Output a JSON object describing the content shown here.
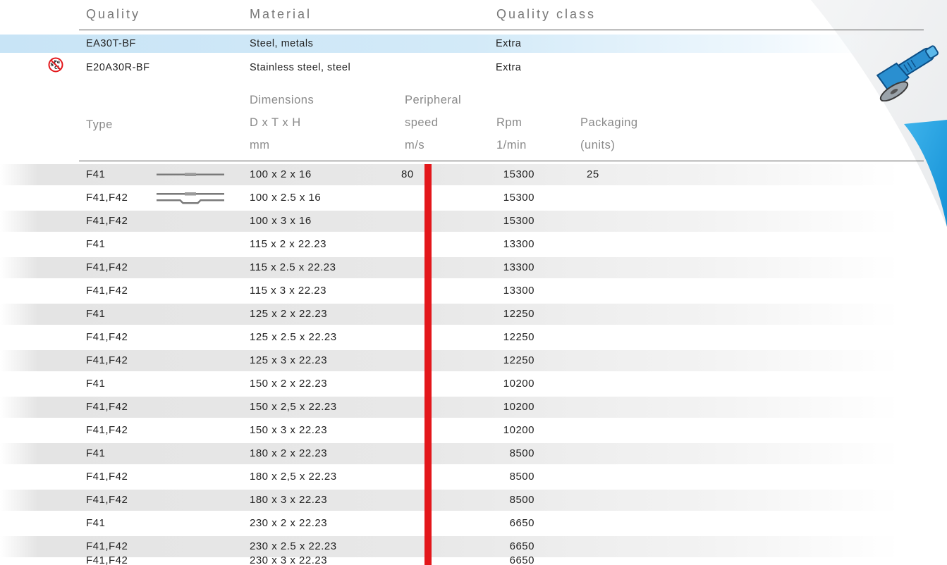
{
  "quality_table": {
    "headers": {
      "quality": "Quality",
      "material": "Material",
      "quality_class": "Quality class"
    },
    "rows": [
      {
        "quality": "EA30T-BF",
        "material": "Steel, metals",
        "quality_class": "Extra",
        "highlighted": true
      },
      {
        "quality": "E20A30R-BF",
        "material": "Stainless steel, steel",
        "quality_class": "Extra",
        "icon": "s-fe-cl-free-icon"
      }
    ]
  },
  "spec_table": {
    "headers": {
      "type": "Type",
      "dimensions": [
        "Dimensions",
        "D x T x H",
        "mm"
      ],
      "speed": [
        "Peripheral",
        "speed",
        "m/s"
      ],
      "rpm": [
        "Rpm",
        "1/min"
      ],
      "packaging": [
        "Packaging",
        "(units)"
      ]
    },
    "rows": [
      {
        "type": "F41",
        "dim": "100 x 2 x 16",
        "speed": "80",
        "rpm": "15300",
        "pack": "25"
      },
      {
        "type": "F41,F42",
        "dim": "100 x 2.5 x 16",
        "speed": "",
        "rpm": "15300",
        "pack": ""
      },
      {
        "type": "F41,F42",
        "dim": "100 x 3 x 16",
        "speed": "",
        "rpm": "15300",
        "pack": ""
      },
      {
        "type": "F41",
        "dim": "115 x 2 x 22.23",
        "speed": "",
        "rpm": "13300",
        "pack": ""
      },
      {
        "type": "F41,F42",
        "dim": "115 x 2.5 x 22.23",
        "speed": "",
        "rpm": "13300",
        "pack": ""
      },
      {
        "type": "F41,F42",
        "dim": "115 x 3 x 22.23",
        "speed": "",
        "rpm": "13300",
        "pack": ""
      },
      {
        "type": "F41",
        "dim": "125 x 2 x 22.23",
        "speed": "",
        "rpm": "12250",
        "pack": ""
      },
      {
        "type": "F41,F42",
        "dim": "125 x 2.5 x 22.23",
        "speed": "",
        "rpm": "12250",
        "pack": ""
      },
      {
        "type": "F41,F42",
        "dim": "125 x 3 x 22.23",
        "speed": "",
        "rpm": "12250",
        "pack": ""
      },
      {
        "type": "F41",
        "dim": "150 x 2 x 22.23",
        "speed": "",
        "rpm": "10200",
        "pack": ""
      },
      {
        "type": "F41,F42",
        "dim": "150 x 2,5 x 22.23",
        "speed": "",
        "rpm": "10200",
        "pack": ""
      },
      {
        "type": "F41,F42",
        "dim": "150 x 3 x 22.23",
        "speed": "",
        "rpm": "10200",
        "pack": ""
      },
      {
        "type": "F41",
        "dim": "180 x 2 x 22.23",
        "speed": "",
        "rpm": "8500",
        "pack": ""
      },
      {
        "type": "F41,F42",
        "dim": "180 x 2,5 x 22.23",
        "speed": "",
        "rpm": "8500",
        "pack": ""
      },
      {
        "type": "F41,F42",
        "dim": "180 x 3 x 22.23",
        "speed": "",
        "rpm": "8500",
        "pack": ""
      },
      {
        "type": "F41",
        "dim": "230 x 2 x 22.23",
        "speed": "",
        "rpm": "6650",
        "pack": ""
      },
      {
        "type": "F41,F42",
        "dim": "230 x 2.5 x 22.23",
        "speed": "",
        "rpm": "6650",
        "pack": ""
      },
      {
        "type": "F41,F42",
        "dim": "230 x 3 x 22.23",
        "speed": "",
        "rpm": "6650",
        "pack": ""
      }
    ]
  },
  "colors": {
    "accent_red": "#e3171b",
    "highlight_blue": "#c8e4f6",
    "swoosh_blue": "#1f9fe0",
    "row_shade": "#e8e8e8"
  },
  "icons": {
    "angle_grinder": "angle-grinder-icon",
    "disc_profile_flat": "disc-profile-f41-icon",
    "disc_profile_depressed": "disc-profile-f42-icon"
  }
}
